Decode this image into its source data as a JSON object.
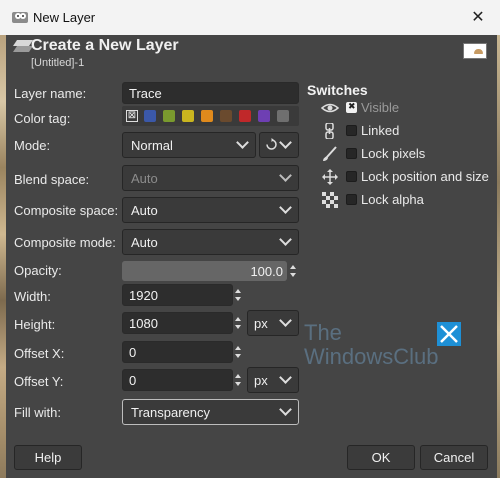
{
  "window": {
    "title": "New Layer",
    "close_glyph": "✕"
  },
  "header": {
    "title": "Create a New Layer",
    "subtitle": "[Untitled]-1"
  },
  "form": {
    "layer_name_label": "Layer name:",
    "layer_name_value": "Trace",
    "color_tag_label": "Color tag:",
    "color_tags": [
      "#3b58a8",
      "#7a9a2e",
      "#c9b51f",
      "#e08a1c",
      "#6a4a2e",
      "#c0282a",
      "#6e3fb3",
      "#6f6f6f"
    ],
    "mode_label": "Mode:",
    "mode_value": "Normal",
    "blend_space_label": "Blend space:",
    "blend_space_value": "Auto",
    "composite_space_label": "Composite space:",
    "composite_space_value": "Auto",
    "composite_mode_label": "Composite mode:",
    "composite_mode_value": "Auto",
    "opacity_label": "Opacity:",
    "opacity_value": "100.0",
    "width_label": "Width:",
    "width_value": "1920",
    "height_label": "Height:",
    "height_value": "1080",
    "size_unit": "px",
    "offset_x_label": "Offset X:",
    "offset_x_value": "0",
    "offset_y_label": "Offset Y:",
    "offset_y_value": "0",
    "offset_unit": "px",
    "fill_label": "Fill with:",
    "fill_value": "Transparency"
  },
  "switches": {
    "title": "Switches",
    "items": [
      {
        "label": "Visible",
        "checked": true,
        "icon": "eye-icon"
      },
      {
        "label": "Linked",
        "checked": false,
        "icon": "chain-icon"
      },
      {
        "label": "Lock pixels",
        "checked": false,
        "icon": "brush-icon"
      },
      {
        "label": "Lock position and size",
        "checked": false,
        "icon": "move-icon"
      },
      {
        "label": "Lock alpha",
        "checked": false,
        "icon": "checkerboard-icon"
      }
    ]
  },
  "watermark": {
    "line1": "The",
    "line2": "WindowsClub"
  },
  "buttons": {
    "help": "Help",
    "ok": "OK",
    "cancel": "Cancel"
  },
  "colors": {
    "dialog_bg": "#454545",
    "field_bg": "#2d2d2d",
    "watermark": "#5a6f80",
    "logo_blue": "#1e90d6"
  }
}
